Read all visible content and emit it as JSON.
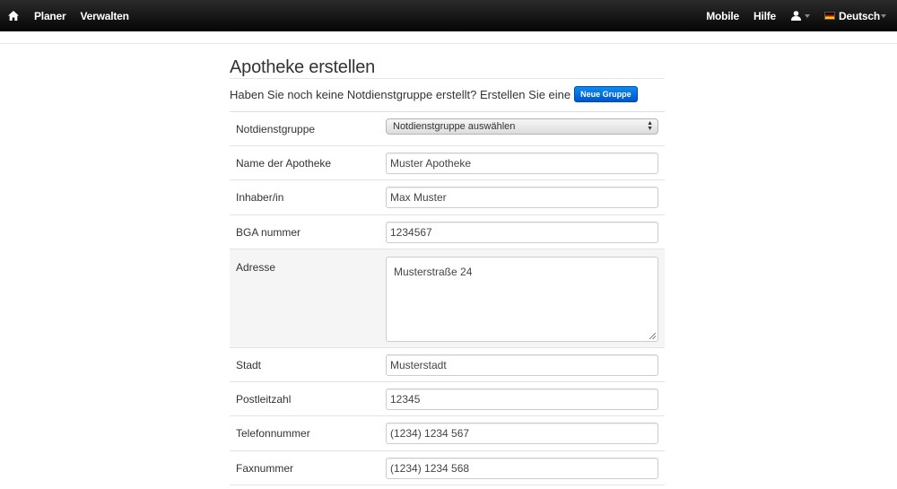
{
  "navbar": {
    "home_icon": "home-icon",
    "left_links": [
      "Planer",
      "Verwalten"
    ],
    "mobile": "Mobile",
    "help": "Hilfe",
    "user_icon": "user-icon",
    "language": "Deutsch"
  },
  "page": {
    "title": "Apotheke erstellen",
    "intro": "Haben Sie noch keine Notdienstgruppe erstellt? Erstellen Sie eine",
    "new_group_button": "Neue Gruppe"
  },
  "form": {
    "group": {
      "label": "Notdienstgruppe",
      "selected": "Notdienstgruppe auswählen"
    },
    "name": {
      "label": "Name der Apotheke",
      "value": "Muster Apotheke"
    },
    "owner": {
      "label": "Inhaber/in",
      "value": "Max Muster"
    },
    "bga": {
      "label": "BGA nummer",
      "value": "1234567"
    },
    "address": {
      "label": "Adresse",
      "value": "Musterstraße 24"
    },
    "city": {
      "label": "Stadt",
      "value": "Musterstadt"
    },
    "zip": {
      "label": "Postleitzahl",
      "value": "12345"
    },
    "phone": {
      "label": "Telefonnummer",
      "value": "(1234) 1234 567"
    },
    "fax": {
      "label": "Faxnummer",
      "value": "(1234) 1234 568"
    }
  }
}
